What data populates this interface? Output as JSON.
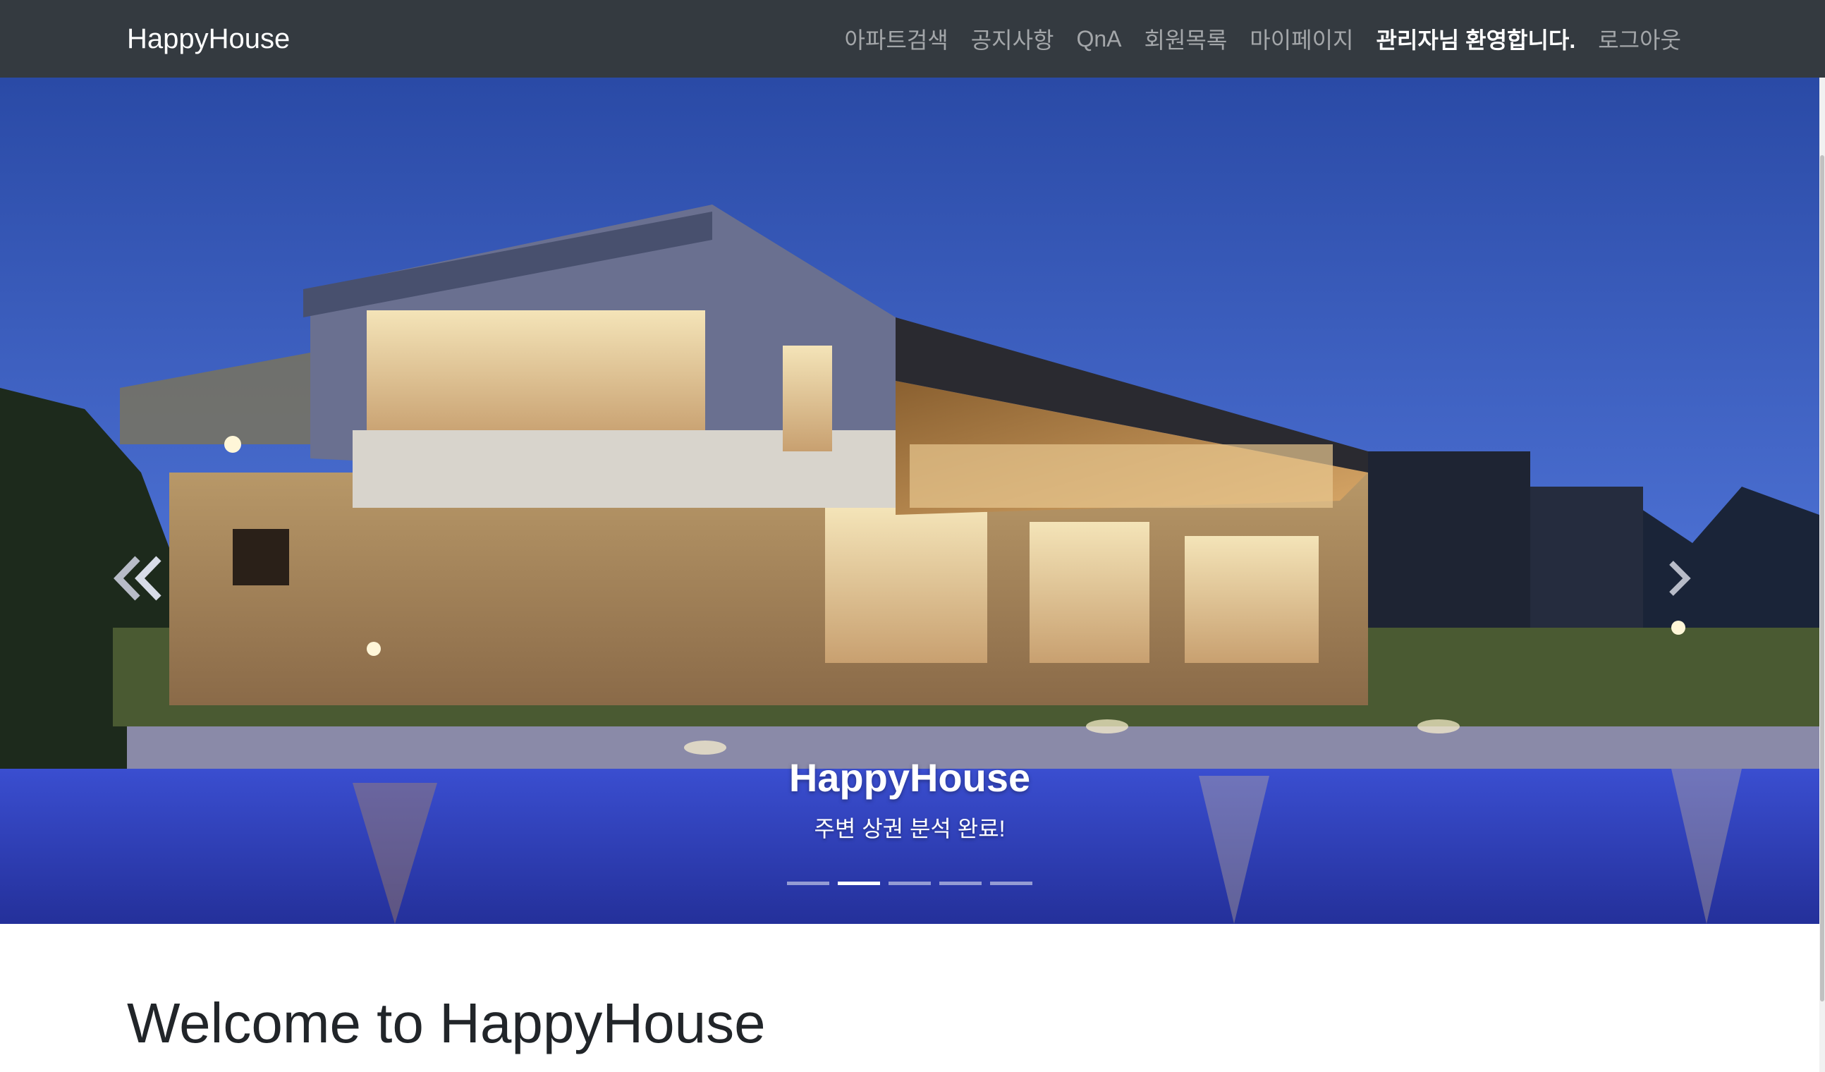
{
  "navbar": {
    "brand": "HappyHouse",
    "links": {
      "apt_search": "아파트검색",
      "notice": "공지사항",
      "qna": "QnA",
      "members": "회원목록",
      "mypage": "마이페이지",
      "welcome": "관리자님 환영합니다.",
      "logout": "로그아웃"
    }
  },
  "carousel": {
    "caption_title": "HappyHouse",
    "caption_text": "주변 상권 분석 완료!",
    "slide_count": 5,
    "active_index": 1,
    "prev_icon": "chevron-left-icon",
    "next_icon": "chevron-right-icon"
  },
  "main": {
    "heading": "Welcome to HappyHouse"
  },
  "colors": {
    "navbar_bg": "#343a40",
    "nav_link": "rgba(255,255,255,0.55)",
    "sky_top": "#2c4fa8",
    "pool": "#2f3fbf"
  }
}
